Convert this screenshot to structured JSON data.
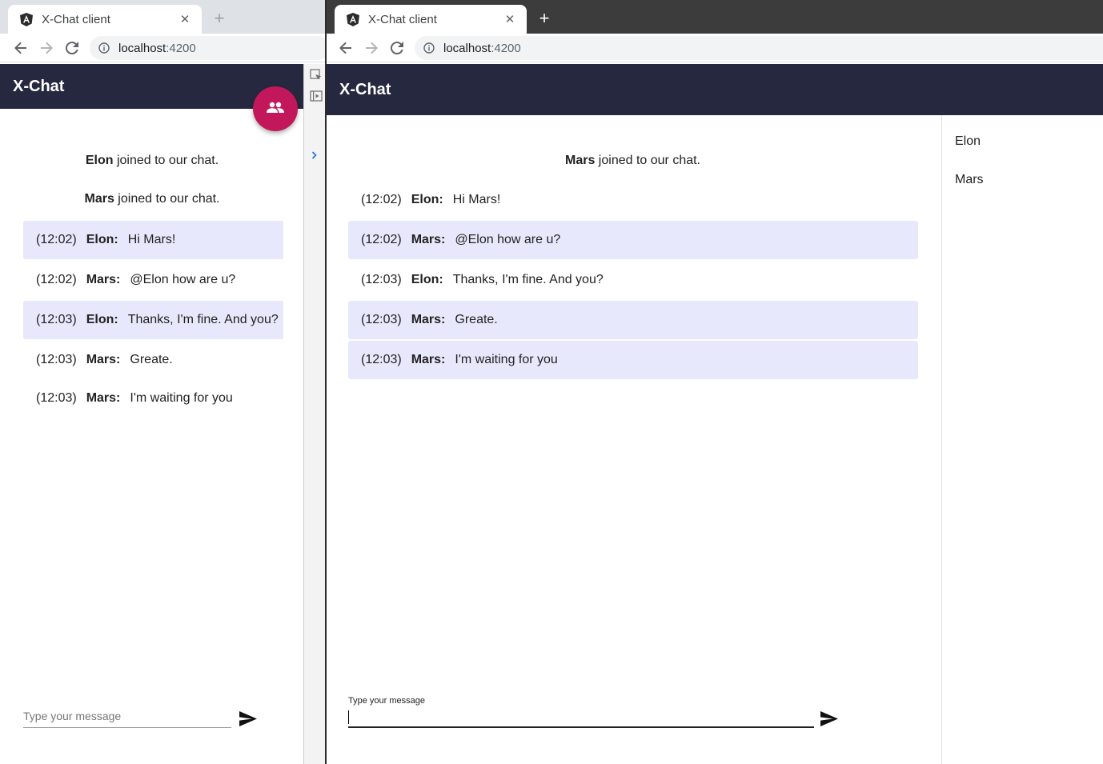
{
  "left_window": {
    "tab_title": "X-Chat client",
    "url_host": "localhost",
    "url_port": ":4200",
    "app_title": "X-Chat",
    "system_messages": [
      {
        "user": "Elon",
        "text": " joined to our chat."
      },
      {
        "user": "Mars",
        "text": " joined to our chat."
      }
    ],
    "messages": [
      {
        "time": "(12:02)",
        "author": "Elon:",
        "text": "Hi Mars!"
      },
      {
        "time": "(12:02)",
        "author": "Mars:",
        "text": "@Elon how are u?"
      },
      {
        "time": "(12:03)",
        "author": "Elon:",
        "text": "Thanks, I'm fine. And you?"
      },
      {
        "time": "(12:03)",
        "author": "Mars:",
        "text": "Greate."
      },
      {
        "time": "(12:03)",
        "author": "Mars:",
        "text": "I'm waiting for you"
      }
    ],
    "input_placeholder": "Type your message",
    "fab_icon": "people-icon"
  },
  "right_window": {
    "tab_title": "X-Chat client",
    "url_host": "localhost",
    "url_port": ":4200",
    "app_title": "X-Chat",
    "system_messages": [
      {
        "user": "Mars",
        "text": " joined to our chat."
      }
    ],
    "messages": [
      {
        "time": "(12:02)",
        "author": "Elon:",
        "text": "Hi Mars!"
      },
      {
        "time": "(12:02)",
        "author": "Mars:",
        "text": "@Elon how are u?"
      },
      {
        "time": "(12:03)",
        "author": "Elon:",
        "text": "Thanks, I'm fine. And you?"
      },
      {
        "time": "(12:03)",
        "author": "Mars:",
        "text": "Greate."
      },
      {
        "time": "(12:03)",
        "author": "Mars:",
        "text": "I'm waiting for you"
      }
    ],
    "input_label": "Type your message",
    "users": [
      "Elon",
      "Mars"
    ]
  },
  "colors": {
    "appbar": "#262840",
    "highlight": "#e8e8fc",
    "fab": "#c2185b"
  }
}
